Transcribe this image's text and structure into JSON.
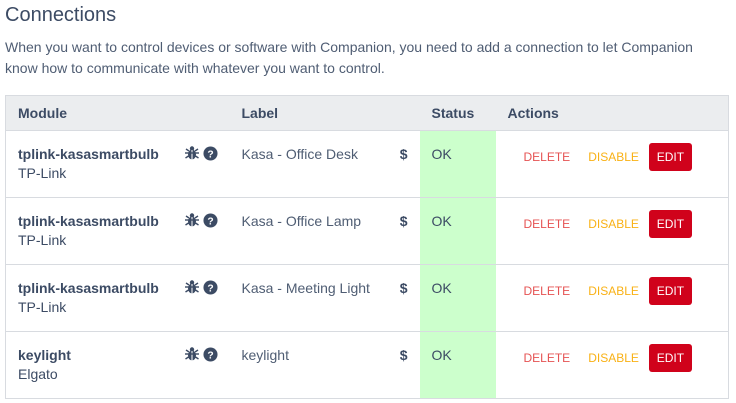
{
  "page": {
    "title": "Connections",
    "description": "When you want to control devices or software with Companion, you need to add a connection to let Companion know how to communicate with whatever you want to control."
  },
  "table": {
    "headers": {
      "module": "Module",
      "label": "Label",
      "status": "Status",
      "actions": "Actions"
    },
    "rows": [
      {
        "module": "tplink-kasasmartbulb",
        "vendor": "TP-Link",
        "label": "Kasa - Office Desk",
        "variables_symbol": "$",
        "status": "OK"
      },
      {
        "module": "tplink-kasasmartbulb",
        "vendor": "TP-Link",
        "label": "Kasa - Office Lamp",
        "variables_symbol": "$",
        "status": "OK"
      },
      {
        "module": "tplink-kasasmartbulb",
        "vendor": "TP-Link",
        "label": "Kasa - Meeting Light",
        "variables_symbol": "$",
        "status": "OK"
      },
      {
        "module": "keylight",
        "vendor": "Elgato",
        "label": "keylight",
        "variables_symbol": "$",
        "status": "OK"
      }
    ],
    "row_icons": [
      "bug-icon",
      "help-circle-icon"
    ]
  },
  "actions": {
    "delete": "DELETE",
    "disable": "DISABLE",
    "edit": "EDIT"
  },
  "colors": {
    "status_ok_bg": "#ccffcc",
    "delete": "#e55353",
    "disable": "#f9b115",
    "edit_bg": "#d0021b",
    "header_bg": "#ebedef"
  }
}
